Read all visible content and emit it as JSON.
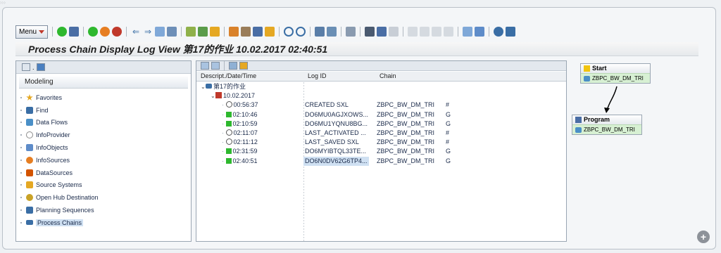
{
  "title": "Process Chain Display Log View 第17的作业 10.02.2017 02:40:51",
  "toolbar": {
    "menu_label": "Menu",
    "icons": [
      "check-icon",
      "save-icon",
      "back-icon",
      "exit-icon",
      "cancel-icon",
      "prev-icon",
      "next-icon",
      "table-icon",
      "filter-icon",
      "tree-icon",
      "chain-icon",
      "log-icon",
      "execute-icon",
      "hierarchy-icon",
      "zoom-in-icon",
      "zoom-out-icon",
      "settings-icon",
      "print-icon",
      "find-icon",
      "find-next-icon",
      "first-page-icon",
      "prev-page-icon",
      "next-page-icon",
      "last-page-icon",
      "create-session-icon",
      "shortcut-icon",
      "help-icon",
      "customize-icon"
    ]
  },
  "left_panel": {
    "modeling_label": "Modeling",
    "items": [
      {
        "label": "Favorites",
        "icon": "star-icon",
        "color": "#e5a823"
      },
      {
        "label": "Find",
        "icon": "binoculars-icon",
        "color": "#3a6ea5"
      },
      {
        "label": "Data Flows",
        "icon": "dataflow-icon",
        "color": "#4a8fc7"
      },
      {
        "label": "InfoProvider",
        "icon": "infoprovider-icon",
        "color": "#8c8c8c"
      },
      {
        "label": "InfoObjects",
        "icon": "infoobject-icon",
        "color": "#5e8cc9"
      },
      {
        "label": "InfoSources",
        "icon": "infosource-icon",
        "color": "#e67e22"
      },
      {
        "label": "DataSources",
        "icon": "datasource-icon",
        "color": "#d35400"
      },
      {
        "label": "Source Systems",
        "icon": "source-system-icon",
        "color": "#e5a823"
      },
      {
        "label": "Open Hub Destination",
        "icon": "open-hub-icon",
        "color": "#c9a227"
      },
      {
        "label": "Planning Sequences",
        "icon": "planning-icon",
        "color": "#3a6ea5"
      },
      {
        "label": "Process Chains",
        "icon": "process-chain-icon",
        "color": "#3a6ea5",
        "selected": true
      }
    ]
  },
  "log_table": {
    "columns": {
      "desc": "Descript./Date/Time",
      "log_id": "Log ID",
      "chain": "Chain"
    },
    "job_label": "第17的作业",
    "date_label": "10.02.2017",
    "rows": [
      {
        "time": "00:56:37",
        "status": "clock",
        "log_id": "CREATED SXL",
        "chain": "ZBPC_BW_DM_TRI",
        "flag": "#"
      },
      {
        "time": "02:10:46",
        "status": "green",
        "log_id": "DO6MU0AGJXOWS...",
        "chain": "ZBPC_BW_DM_TRI",
        "flag": "G"
      },
      {
        "time": "02:10:59",
        "status": "green",
        "log_id": "DO6MU1YQNU8BG...",
        "chain": "ZBPC_BW_DM_TRI",
        "flag": "G"
      },
      {
        "time": "02:11:07",
        "status": "clock",
        "log_id": "LAST_ACTIVATED ...",
        "chain": "ZBPC_BW_DM_TRI",
        "flag": "#"
      },
      {
        "time": "02:11:12",
        "status": "clock",
        "log_id": "LAST_SAVED SXL",
        "chain": "ZBPC_BW_DM_TRI",
        "flag": "#"
      },
      {
        "time": "02:31:59",
        "status": "green",
        "log_id": "DO6MYIBTQL33TE...",
        "chain": "ZBPC_BW_DM_TRI",
        "flag": "G"
      },
      {
        "time": "02:40:51",
        "status": "green",
        "log_id": "DO6N0DV62G6TP4...",
        "chain": "ZBPC_BW_DM_TRI",
        "flag": "G",
        "selected": true
      }
    ]
  },
  "diagram": {
    "start": {
      "title": "Start",
      "chain": "ZBPC_BW_DM_TRI"
    },
    "program": {
      "title": "Program",
      "chain": "ZBPC_BW_DM_TRI"
    }
  }
}
